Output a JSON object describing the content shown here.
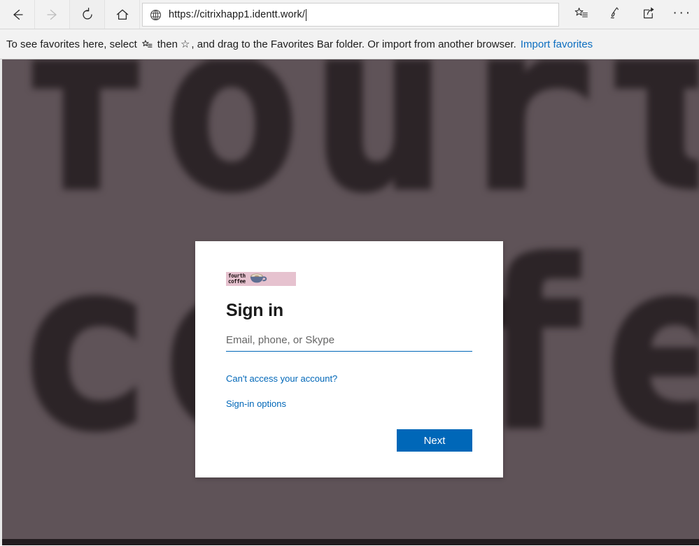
{
  "browser": {
    "nav": {
      "back_label": "Back",
      "forward_label": "Forward",
      "refresh_label": "Refresh",
      "home_label": "Home"
    },
    "address": {
      "url": "https://citrixhapp1.identt.work/",
      "security_icon": "globe-icon"
    },
    "tools": {
      "favorites_label": "Favorites",
      "notes_label": "Notes",
      "share_label": "Share",
      "more_label": "···"
    },
    "favorites_bar": {
      "text_part1": "To see favorites here, select",
      "star_list_icon": "favorites-list-icon",
      "text_part2": "then",
      "star_glyph": "☆",
      "text_part3": ", and drag to the Favorites Bar folder. Or import from another browser.",
      "import_link": "Import favorites"
    }
  },
  "page": {
    "background": {
      "wordmark_line1": "fourth",
      "wordmark_line2": "coffee",
      "bg_color": "#5f5358",
      "wordmark_color": "#2c2427"
    },
    "signin": {
      "logo": {
        "line1": "fourth",
        "line2": "coffee",
        "banner_color": "#e6c2cf",
        "cup_icon": "coffee-cup-icon"
      },
      "title": "Sign in",
      "email_placeholder": "Email, phone, or Skype",
      "email_value": "",
      "cant_access_link": "Can't access your account?",
      "signin_options_link": "Sign-in options",
      "next_button": "Next",
      "accent_color": "#0067b8"
    }
  }
}
